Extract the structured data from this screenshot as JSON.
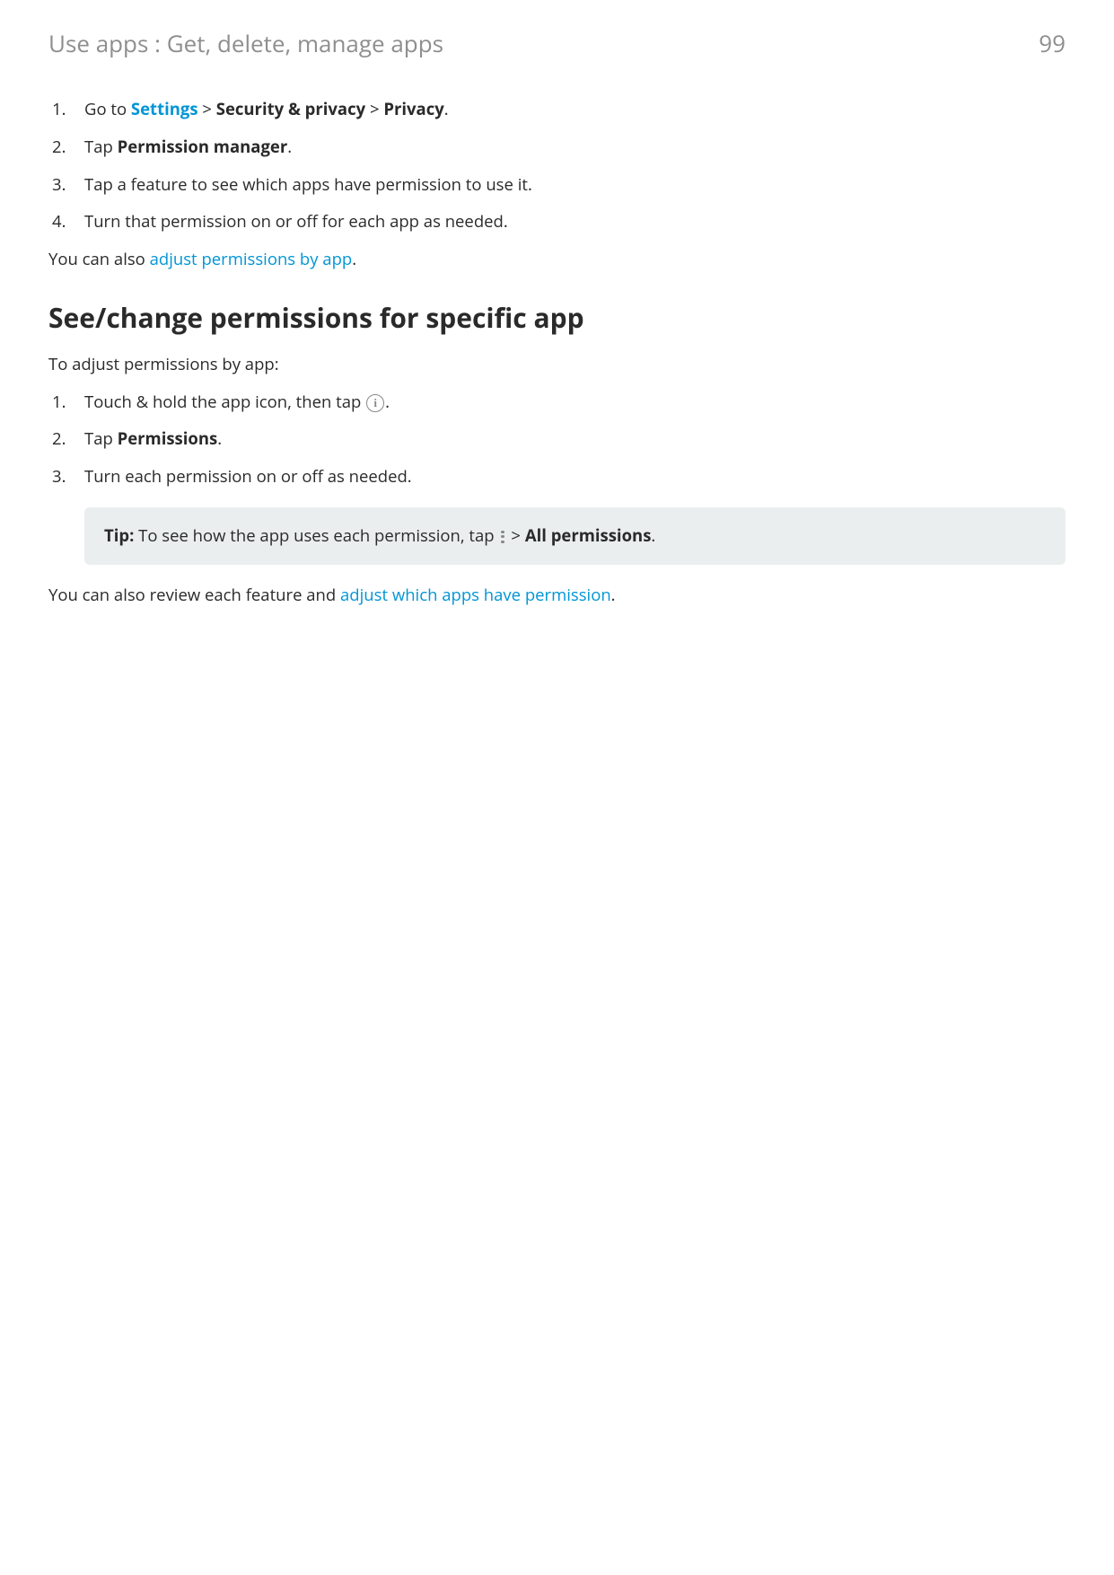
{
  "header": {
    "breadcrumb": "Use apps : Get, delete, manage apps",
    "page_number": "99"
  },
  "list1": {
    "item1": {
      "num": "1.",
      "prefix": "Go to ",
      "settings_link": "Settings",
      "sep1": " > ",
      "security": "Security & privacy",
      "sep2": " > ",
      "privacy": "Privacy",
      "suffix": "."
    },
    "item2": {
      "num": "2.",
      "prefix": "Tap ",
      "bold": "Permission manager",
      "suffix": "."
    },
    "item3": {
      "num": "3.",
      "text": "Tap a feature to see which apps have permission to use it."
    },
    "item4": {
      "num": "4.",
      "text": "Turn that permission on or off for each app as needed."
    }
  },
  "para1": {
    "prefix": "You can also ",
    "link": "adjust permissions by app",
    "suffix": "."
  },
  "section_heading": "See/change permissions for specific app",
  "para2": "To adjust permissions by app:",
  "list2": {
    "item1": {
      "num": "1.",
      "prefix": "Touch & hold the app icon, then tap ",
      "suffix": "."
    },
    "item2": {
      "num": "2.",
      "prefix": "Tap ",
      "bold": "Permissions",
      "suffix": "."
    },
    "item3": {
      "num": "3.",
      "text": "Turn each permission on or off as needed."
    }
  },
  "tip": {
    "label": "Tip:",
    "prefix": " To see how the app uses each permission, tap ",
    "sep": " > ",
    "bold": "All permissions",
    "suffix": "."
  },
  "para3": {
    "prefix": "You can also review each feature and ",
    "link": "adjust which apps have permission",
    "suffix": "."
  }
}
